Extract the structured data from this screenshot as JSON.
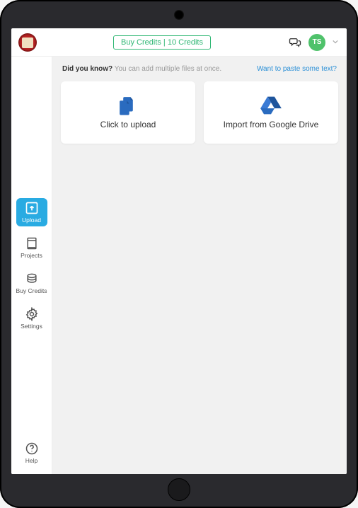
{
  "header": {
    "credits_label": "Buy Credits | 10 Credits",
    "avatar_initials": "TS",
    "colors": {
      "accent_green": "#2eb673",
      "avatar_bg": "#4fc26b",
      "active_blue": "#29abe2"
    }
  },
  "info": {
    "did_you_know_lead": "Did you know?",
    "did_you_know_sub": "You can add multiple files at once.",
    "paste_link": "Want to paste some text?"
  },
  "cards": {
    "upload": {
      "label": "Click to upload"
    },
    "gdrive": {
      "label": "Import from Google Drive"
    }
  },
  "sidebar": {
    "upload": "Upload",
    "projects": "Projects",
    "buy_credits": "Buy Credits",
    "settings": "Settings",
    "help": "Help"
  }
}
